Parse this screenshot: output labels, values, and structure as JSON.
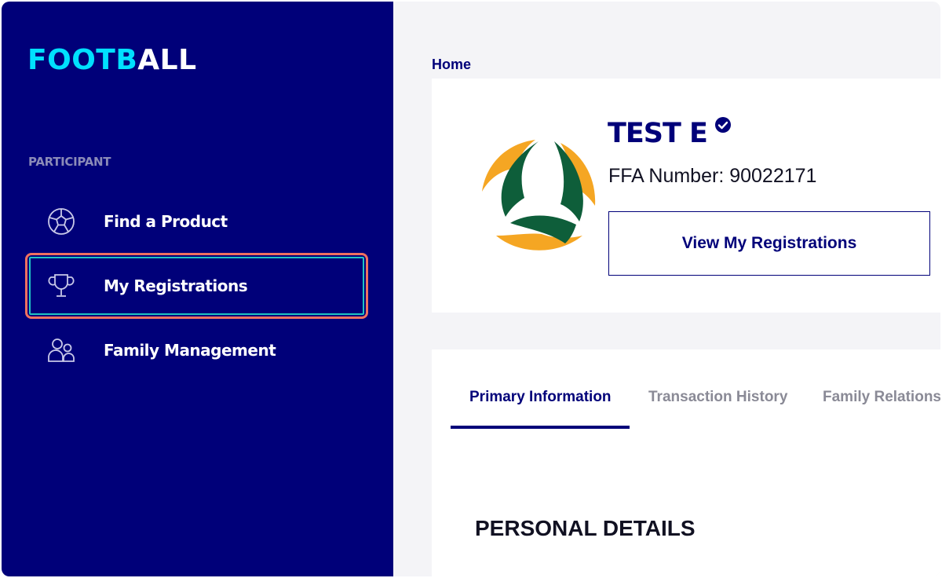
{
  "sidebar": {
    "logo_part1": "FOOTB",
    "logo_part2": "ALL",
    "section_label": "PARTICIPANT",
    "items": [
      {
        "label": "Find a Product",
        "icon": "soccer-ball-icon"
      },
      {
        "label": "My Registrations",
        "icon": "trophy-icon",
        "active": true
      },
      {
        "label": "Family Management",
        "icon": "family-icon"
      }
    ]
  },
  "breadcrumb": "Home",
  "profile": {
    "name": "TEST E",
    "verified_icon": "verified-check-icon",
    "ffa_number": "FFA Number: 90022171",
    "view_button_label": "View My Registrations"
  },
  "tabs": [
    {
      "label": "Primary Information",
      "active": true
    },
    {
      "label": "Transaction History"
    },
    {
      "label": "Family Relationsl"
    }
  ],
  "section_title": "PERSONAL DETAILS",
  "colors": {
    "navy": "#000079",
    "cyan": "#00e0ff",
    "highlight": "#f07060",
    "emblem_green": "#0e5e3a",
    "emblem_gold": "#f5a623"
  }
}
